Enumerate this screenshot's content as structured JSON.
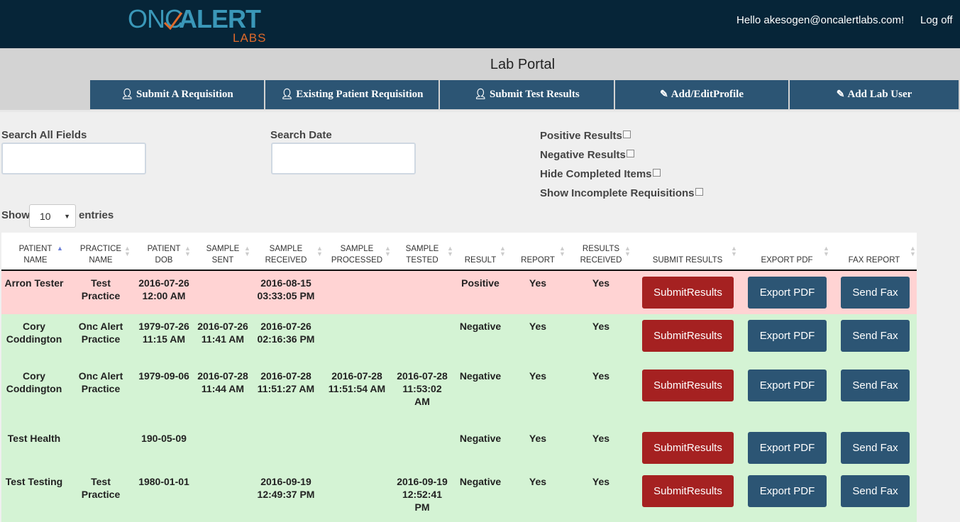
{
  "header": {
    "logo_onc": "ONC",
    "logo_alert": "ALERT",
    "logo_labs": "LABS",
    "greeting": "Hello akesogen@oncalertlabs.com!",
    "logoff": "Log off"
  },
  "portal": {
    "title": "Lab Portal",
    "nav": [
      {
        "label": "Submit A Requisition",
        "icon": "user-icon"
      },
      {
        "label": "Existing Patient Requisition",
        "icon": "user-icon"
      },
      {
        "label": "Submit Test Results",
        "icon": "user-icon"
      },
      {
        "label": "Add/EditProfile",
        "icon": "edit-icon"
      },
      {
        "label": "Add Lab User",
        "icon": "edit-icon"
      }
    ]
  },
  "filters": {
    "search_all_label": "Search All Fields",
    "search_all_value": "",
    "search_date_label": "Search Date",
    "search_date_value": "",
    "checkboxes": [
      {
        "label": "Positive Results",
        "checked": false
      },
      {
        "label": "Negative Results",
        "checked": false
      },
      {
        "label": "Hide Completed Items",
        "checked": false
      },
      {
        "label": "Show Incomplete Requisitions",
        "checked": false
      }
    ]
  },
  "length": {
    "show": "Show",
    "value": "10",
    "entries": "entries"
  },
  "table": {
    "columns": [
      {
        "l1": "PATIENT",
        "l2": "NAME"
      },
      {
        "l1": "PRACTICE",
        "l2": "NAME"
      },
      {
        "l1": "PATIENT",
        "l2": "DOB"
      },
      {
        "l1": "SAMPLE",
        "l2": "SENT"
      },
      {
        "l1": "SAMPLE",
        "l2": "RECEIVED"
      },
      {
        "l1": "SAMPLE",
        "l2": "PROCESSED"
      },
      {
        "l1": "SAMPLE",
        "l2": "TESTED"
      },
      {
        "l1": "",
        "l2": "RESULT"
      },
      {
        "l1": "",
        "l2": "REPORT"
      },
      {
        "l1": "RESULTS",
        "l2": "RECEIVED"
      },
      {
        "l1": "",
        "l2": "SUBMIT RESULTS"
      },
      {
        "l1": "",
        "l2": "EXPORT PDF"
      },
      {
        "l1": "",
        "l2": "FAX REPORT"
      }
    ],
    "submit_label": "SubmitResults",
    "export_label": "Export PDF",
    "fax_label": "Send Fax",
    "rows": [
      {
        "status": "pos",
        "cells": [
          "Arron Tester",
          "Test Practice",
          "2016-07-26 12:00 AM",
          "",
          "2016-08-15 03:33:05 PM",
          "",
          "",
          "Positive",
          "Yes",
          "Yes"
        ]
      },
      {
        "status": "neg",
        "cells": [
          "Cory Coddington",
          "Onc Alert Practice",
          "1979-07-26 11:15 AM",
          "2016-07-26 11:41 AM",
          "2016-07-26 02:16:36 PM",
          "",
          "",
          "Negative",
          "Yes",
          "Yes"
        ]
      },
      {
        "status": "neg",
        "cells": [
          "Cory Coddington",
          "Onc Alert Practice",
          "1979-09-06",
          "2016-07-28 11:44 AM",
          "2016-07-28 11:51:27 AM",
          "2016-07-28 11:51:54 AM",
          "2016-07-28 11:53:02 AM",
          "Negative",
          "Yes",
          "Yes"
        ]
      },
      {
        "status": "neg",
        "cells": [
          "Test Health",
          "",
          "190-05-09",
          "",
          "",
          "",
          "",
          "Negative",
          "Yes",
          "Yes"
        ]
      },
      {
        "status": "neg",
        "cells": [
          "Test Testing",
          "Test Practice",
          "1980-01-01",
          "",
          "2016-09-19 12:49:37 PM",
          "",
          "2016-09-19 12:52:41 PM",
          "Negative",
          "Yes",
          "Yes"
        ]
      }
    ]
  }
}
